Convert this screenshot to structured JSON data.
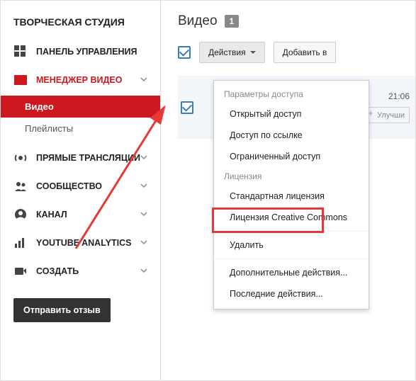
{
  "sidebar": {
    "title": "ТВОРЧЕСКАЯ СТУДИЯ",
    "items": [
      {
        "label": "ПАНЕЛЬ УПРАВЛЕНИЯ",
        "icon": "dashboard-icon",
        "active": false,
        "expandable": false
      },
      {
        "label": "МЕНЕДЖЕР ВИДЕО",
        "icon": "film-icon",
        "active": true,
        "expandable": true,
        "sub": [
          {
            "label": "Видео",
            "active": true
          },
          {
            "label": "Плейлисты",
            "active": false
          }
        ]
      },
      {
        "label": "ПРЯМЫЕ ТРАНСЛЯЦИИ",
        "icon": "live-icon",
        "expandable": true
      },
      {
        "label": "СООБЩЕСТВО",
        "icon": "community-icon",
        "expandable": true
      },
      {
        "label": "КАНАЛ",
        "icon": "channel-icon",
        "expandable": true
      },
      {
        "label": "YOUTUBE ANALYTICS",
        "icon": "analytics-icon",
        "expandable": true
      },
      {
        "label": "СОЗДАТЬ",
        "icon": "create-icon",
        "expandable": true
      }
    ],
    "feedback_label": "Отправить отзыв"
  },
  "main": {
    "page_title": "Видео",
    "video_count": "1",
    "toolbar": {
      "actions_label": "Действия",
      "addto_label": "Добавить в"
    },
    "row": {
      "time": "21:06",
      "improve_label": "Улучши"
    }
  },
  "menu": {
    "section_access": "Параметры доступа",
    "items_access": [
      "Открытый доступ",
      "Доступ по ссылке",
      "Ограниченный доступ"
    ],
    "section_license": "Лицензия",
    "items_license": [
      "Стандартная лицензия",
      "Лицензия Creative Commons"
    ],
    "delete_label": "Удалить",
    "more_label": "Дополнительные действия...",
    "recent_label": "Последние действия..."
  }
}
